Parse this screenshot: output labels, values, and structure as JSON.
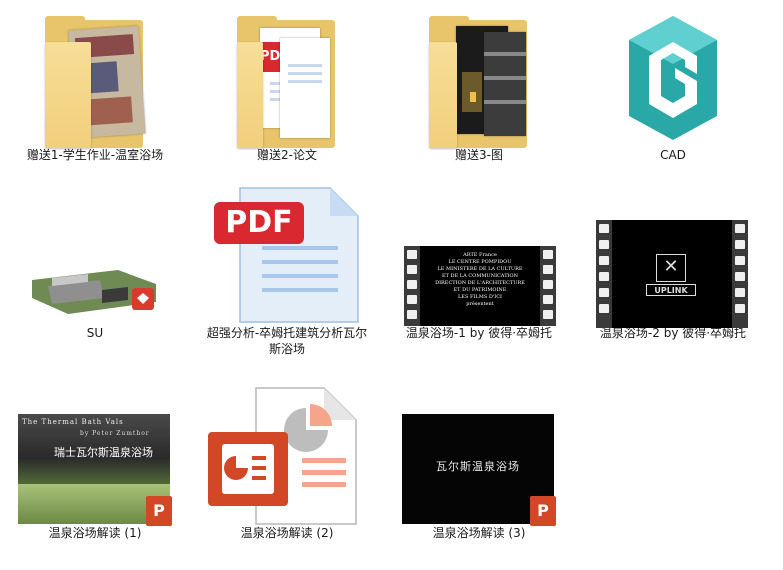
{
  "window": {
    "view": "large-icons"
  },
  "items": [
    {
      "label": "赠送1-学生作业-温室浴场",
      "icon": "folder-icon"
    },
    {
      "label": "赠送2-论文",
      "icon": "folder-icon"
    },
    {
      "label": "赠送3-图",
      "icon": "folder-icon"
    },
    {
      "label": "CAD",
      "icon": "cad-icon"
    },
    {
      "label": "SU",
      "icon": "sketchup-icon"
    },
    {
      "label": "超强分析-卒姆托建筑分析瓦尔斯浴场",
      "icon": "pdf-icon"
    },
    {
      "label": "温泉浴场-1 by 彼得·卒姆托",
      "icon": "video-icon"
    },
    {
      "label": "温泉浴场-2 by 彼得·卒姆托",
      "icon": "video-icon"
    },
    {
      "label": "温泉浴场解读 (1)",
      "icon": "powerpoint-icon"
    },
    {
      "label": "温泉浴场解读 (2)",
      "icon": "powerpoint-icon"
    },
    {
      "label": "温泉浴场解读 (3)",
      "icon": "powerpoint-icon"
    }
  ],
  "thumb_text": {
    "pdf_badge": "PDF",
    "ppt_badge": "P",
    "video1_lines": [
      "ARTE France",
      "LE CENTRE POMPIDOU",
      "LE MINISTERE DE LA CULTURE",
      "ET DE LA COMMUNICATION",
      "DIRECTION DE L'ARCHITECTURE",
      "ET DU PATRIMOINE",
      "LES FILMS D'ICI",
      "présentent"
    ],
    "video2_logo": "UPLINK",
    "ppt1_title": "The Thermal Bath Vals",
    "ppt1_sub": "by Peter Zumthor",
    "ppt1_cn": "瑞士瓦尔斯温泉浴场",
    "ppt3_cn": "瓦尔斯温泉浴场"
  },
  "colors": {
    "folder": "#f1cf7b",
    "pdf_red": "#d9282f",
    "ppt_orange": "#d24726",
    "cad_teal": "#2aa7a7"
  }
}
